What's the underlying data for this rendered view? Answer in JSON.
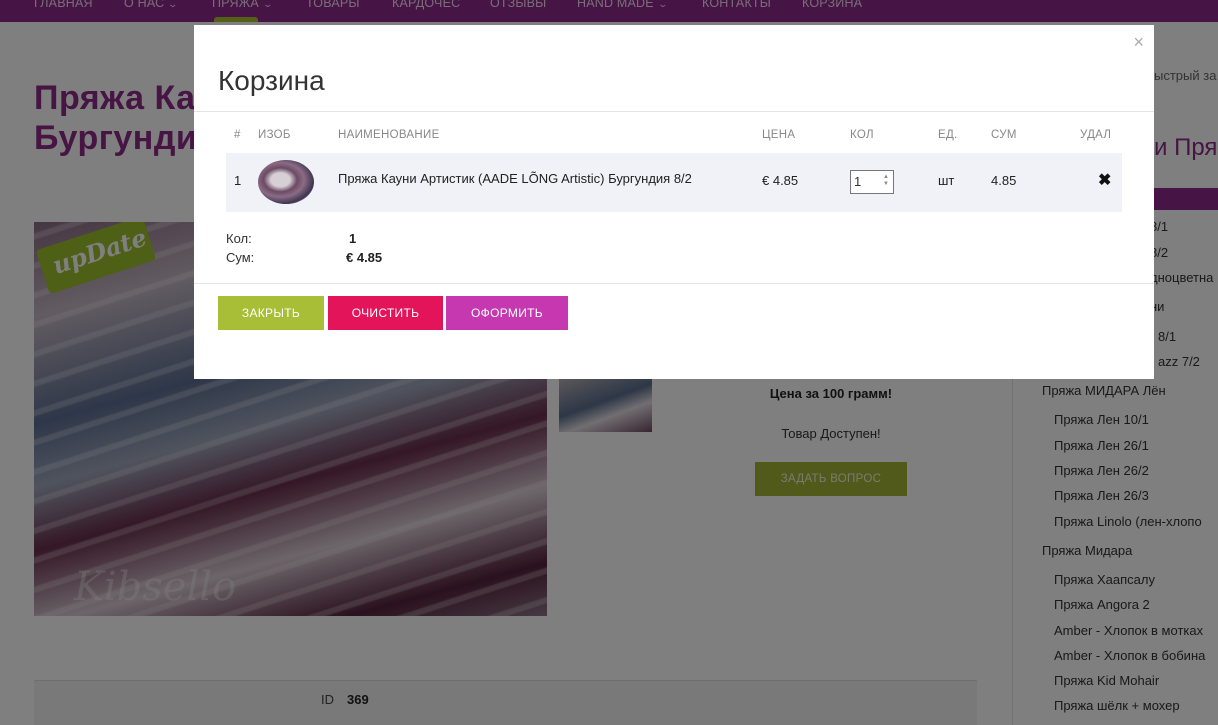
{
  "nav": {
    "items": [
      "ГЛАВНАЯ",
      "О НАС",
      "ПРЯЖА",
      "ТОВАРЫ",
      "КАРДОЧЕС",
      "ОТЗЫВЫ",
      "HAND MADE",
      "КОНТАКТЫ",
      "КОРЗИНА"
    ],
    "chevron": "⌄"
  },
  "page": {
    "title_line1": "Пряжа Ка",
    "title_line2": "Бургунди",
    "badge": "upDate",
    "watermark": "Kibsello",
    "price_note": "Цена за 100 грамм!",
    "availability": "Товар Доступен!",
    "ask_button": "ЗАДАТЬ ВОПРОС",
    "id_label": "ID",
    "id_value": "369"
  },
  "sidebar": {
    "top_snippet": "ыстрый за",
    "heading_snippet": "и Пря",
    "items": [
      "8/1",
      "8/2",
      "дноцветна",
      "ни",
      "8/1",
      "azz 7/2",
      "Пряжа МИДАРА Лён",
      "Пряжа Лен 10/1",
      "Пряжа Лен 26/1",
      "Пряжа Лен 26/2",
      "Пряжа Лен 26/3",
      "Пряжа Linolo (лен-хлопо",
      "Пряжа Мидара",
      "Пряжа Хаапсалу",
      "Пряжа Angora 2",
      "Amber - Хлопок в мотках",
      "Amber - Хлопок в бобина",
      "Пряжа Kid Mohair",
      "Пряжа шёлк + мохер"
    ]
  },
  "modal": {
    "close_icon": "×",
    "title": "Корзина",
    "columns": {
      "num": "#",
      "img": "ИЗОБ",
      "name": "НАИМЕНОВАНИЕ",
      "price": "ЦЕНА",
      "qty": "КОЛ",
      "unit": "ЕД.",
      "sum": "СУМ",
      "del": "УДАЛ"
    },
    "rows": [
      {
        "num": "1",
        "name": "Пряжа Кауни Артистик (AADE LÕNG Artistic) Бургундия 8/2",
        "price": "€ 4.85",
        "qty": "1",
        "unit": "шт",
        "sum": "4.85",
        "delete_icon": "✖"
      }
    ],
    "totals": {
      "qty_label": "Кол:",
      "qty_value": "1",
      "sum_label": "Сум:",
      "sum_value": "€ 4.85"
    },
    "buttons": {
      "close": "ЗАКРЫТЬ",
      "clear": "ОЧИСТИТЬ",
      "checkout": "ОФОРМИТЬ"
    }
  }
}
